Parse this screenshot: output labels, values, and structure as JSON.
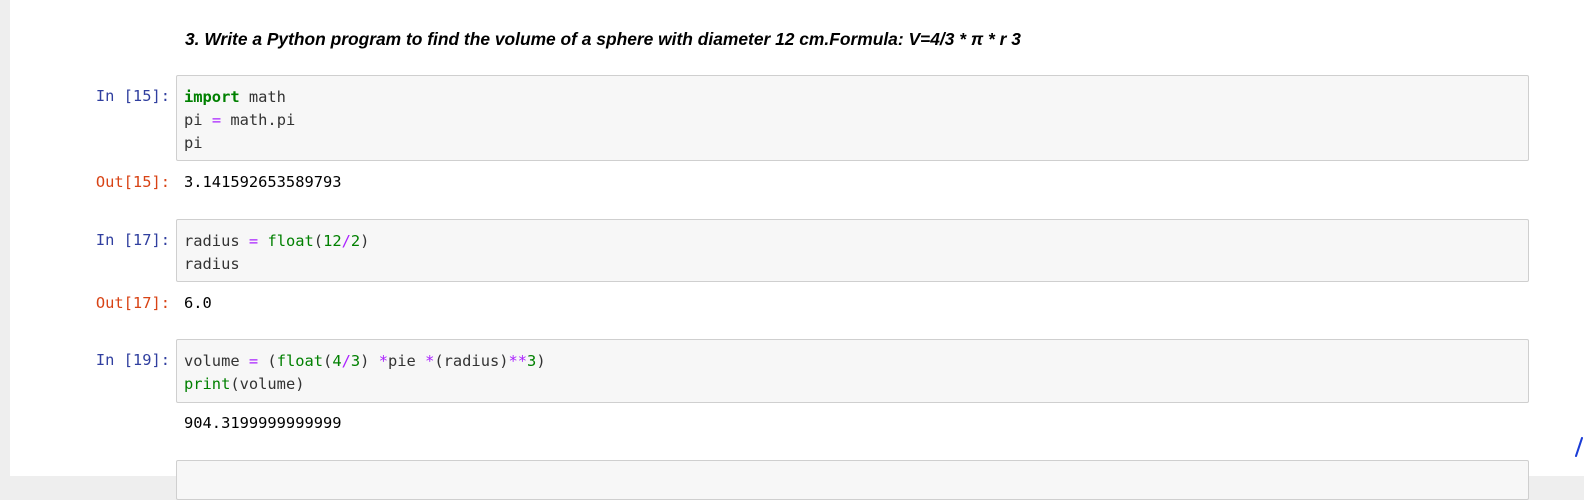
{
  "heading": "3. Write a Python program to find the volume of a sphere with diameter 12 cm.Formula: V=4/3 * π * r 3",
  "cells": [
    {
      "in_prompt": "In [15]:",
      "out_prompt": "Out[15]:",
      "output": "3.141592653589793",
      "lines": [
        [
          {
            "t": "import",
            "c": "kw"
          },
          {
            "t": " math",
            "c": ""
          }
        ],
        [
          {
            "t": "pi ",
            "c": ""
          },
          {
            "t": "=",
            "c": "op"
          },
          {
            "t": " math.pi",
            "c": ""
          }
        ],
        [
          {
            "t": "pi",
            "c": ""
          }
        ]
      ]
    },
    {
      "in_prompt": "In [17]:",
      "out_prompt": "Out[17]:",
      "output": "6.0",
      "lines": [
        [
          {
            "t": "radius ",
            "c": ""
          },
          {
            "t": "=",
            "c": "op"
          },
          {
            "t": " ",
            "c": ""
          },
          {
            "t": "float",
            "c": "bi"
          },
          {
            "t": "(",
            "c": ""
          },
          {
            "t": "12",
            "c": "num"
          },
          {
            "t": "/",
            "c": "op"
          },
          {
            "t": "2",
            "c": "num"
          },
          {
            "t": ")",
            "c": ""
          }
        ],
        [
          {
            "t": "radius",
            "c": ""
          }
        ]
      ]
    },
    {
      "in_prompt": "In [19]:",
      "out_prompt": "",
      "output": "904.3199999999999",
      "lines": [
        [
          {
            "t": "volume ",
            "c": ""
          },
          {
            "t": "=",
            "c": "op"
          },
          {
            "t": " (",
            "c": ""
          },
          {
            "t": "float",
            "c": "bi"
          },
          {
            "t": "(",
            "c": ""
          },
          {
            "t": "4",
            "c": "num"
          },
          {
            "t": "/",
            "c": "op"
          },
          {
            "t": "3",
            "c": "num"
          },
          {
            "t": ") ",
            "c": ""
          },
          {
            "t": "*",
            "c": "op"
          },
          {
            "t": "pie ",
            "c": ""
          },
          {
            "t": "*",
            "c": "op"
          },
          {
            "t": "(radius)",
            "c": ""
          },
          {
            "t": "**",
            "c": "op"
          },
          {
            "t": "3",
            "c": "num"
          },
          {
            "t": ")",
            "c": ""
          }
        ],
        [
          {
            "t": "print",
            "c": "bi"
          },
          {
            "t": "(volume)",
            "c": ""
          }
        ]
      ]
    }
  ]
}
